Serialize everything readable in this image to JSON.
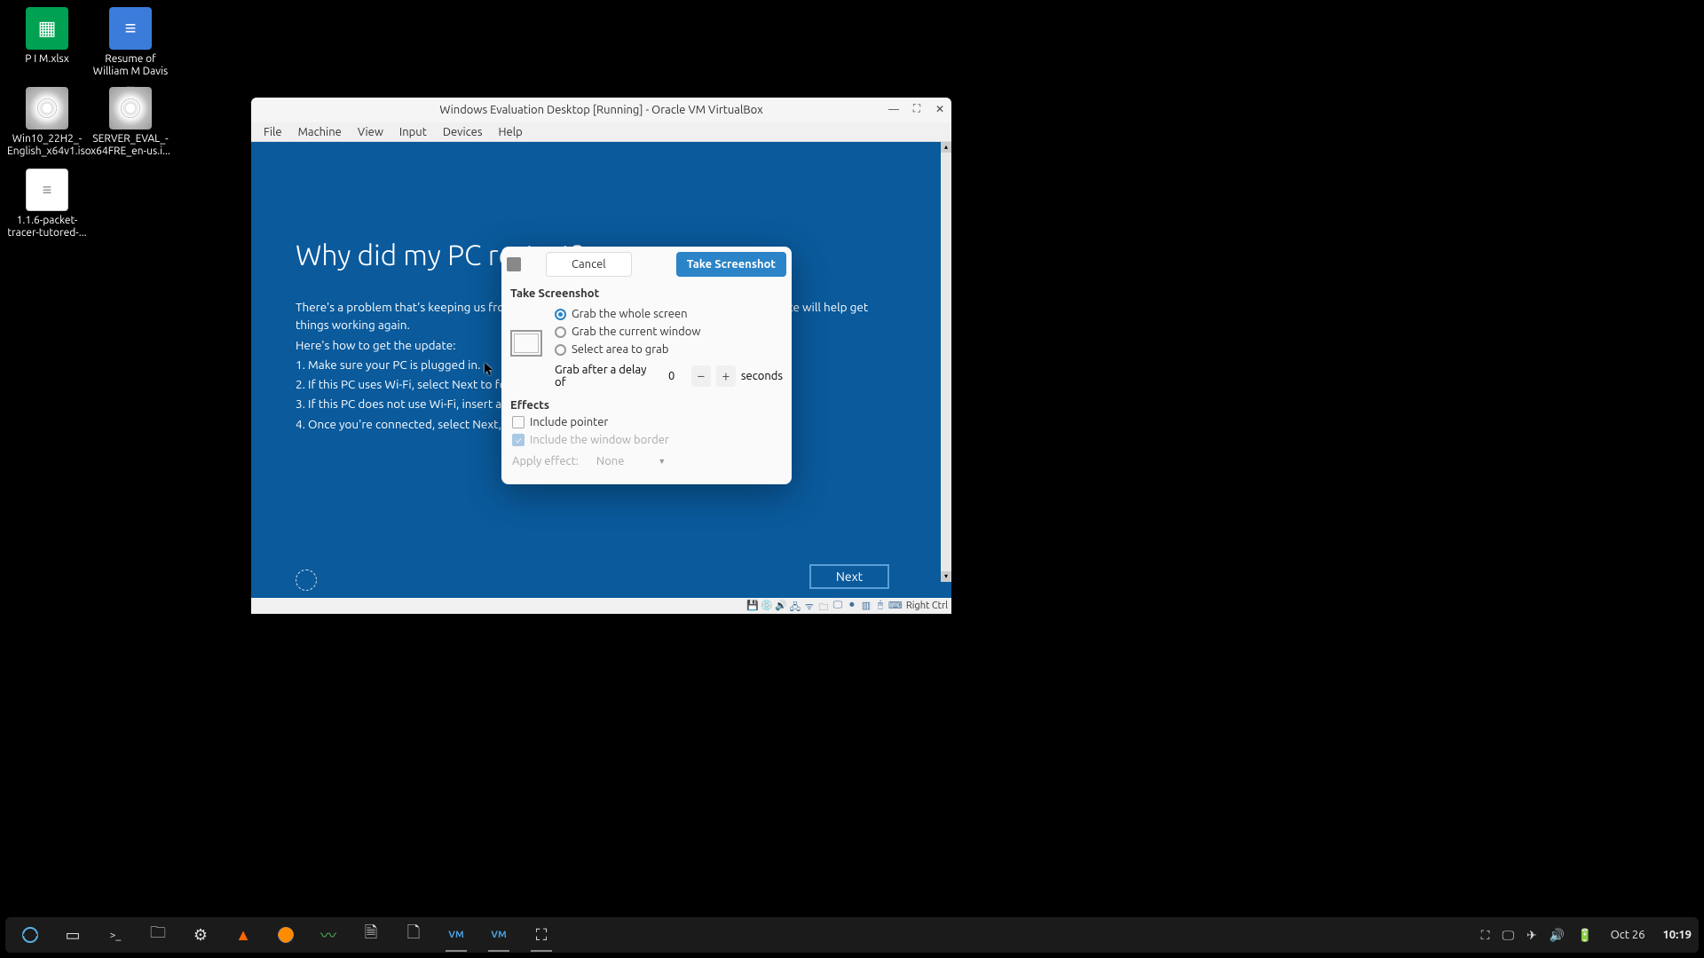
{
  "desktop_icons": [
    {
      "label": "P I M.xlsx",
      "type": "sheet"
    },
    {
      "label": "Resume of William M Davis ...",
      "type": "doc"
    },
    {
      "label": "Win10_22H2_-English_x64v1.iso",
      "type": "disc"
    },
    {
      "label": "SERVER_EVAL_-x64FRE_en-us.i...",
      "type": "disc"
    },
    {
      "label": "1.1.6-packet-tracer-tutored-...",
      "type": "textfile"
    }
  ],
  "vbox": {
    "title": "Windows Evaluation Desktop [Running] - Oracle VM VirtualBox",
    "menu": [
      "File",
      "Machine",
      "View",
      "Input",
      "Devices",
      "Help"
    ],
    "host_key": "Right Ctrl"
  },
  "oobe": {
    "heading": "Why did my PC restart?",
    "lines": [
      "There's a problem that's keeping us from getting your PC ready to use, but we think an update will help get things working again.",
      "Here's how to get the update:",
      "1. Make sure your PC is plugged in.",
      "2. If this PC uses Wi-Fi, select Next to follow instructions to finish connecting to a network.",
      "3. If this PC does not use Wi-Fi, insert a network cable.",
      "4. Once you're connected, select Next, and the update will install."
    ],
    "next_label": "Next"
  },
  "screenshot_dialog": {
    "cancel_label": "Cancel",
    "take_label": "Take Screenshot",
    "section_take": "Take Screenshot",
    "options": {
      "whole": "Grab the whole screen",
      "window": "Grab the current window",
      "area": "Select area to grab",
      "selected": "whole"
    },
    "delay": {
      "label_before": "Grab after a delay of",
      "value": "0",
      "label_after": "seconds"
    },
    "section_effects": "Effects",
    "effects": {
      "include_pointer": "Include pointer",
      "include_border": "Include the window border",
      "apply_label": "Apply effect:",
      "apply_value": "None"
    }
  },
  "taskbar": {
    "items": [
      {
        "name": "start",
        "glyph": "◉"
      },
      {
        "name": "files",
        "glyph": "▭"
      },
      {
        "name": "terminal",
        "glyph": ">_"
      },
      {
        "name": "file-manager",
        "glyph": "🗀"
      },
      {
        "name": "settings",
        "glyph": "⚙"
      },
      {
        "name": "vlc",
        "glyph": "▲"
      },
      {
        "name": "firefox",
        "glyph": "🦊"
      },
      {
        "name": "system-monitor",
        "glyph": "〰"
      },
      {
        "name": "notes",
        "glyph": "🗎"
      },
      {
        "name": "text-editor",
        "glyph": "🗋"
      },
      {
        "name": "virtualbox-vm",
        "glyph": "VM"
      },
      {
        "name": "virtualbox",
        "glyph": "VM"
      },
      {
        "name": "screenshot",
        "glyph": "⛶"
      }
    ],
    "tray": {
      "screen": "⛶",
      "display": "🖵",
      "airplane": "✈",
      "volume": "🔊",
      "battery": "🔋"
    },
    "date": "Oct 26",
    "time": "10:19"
  }
}
